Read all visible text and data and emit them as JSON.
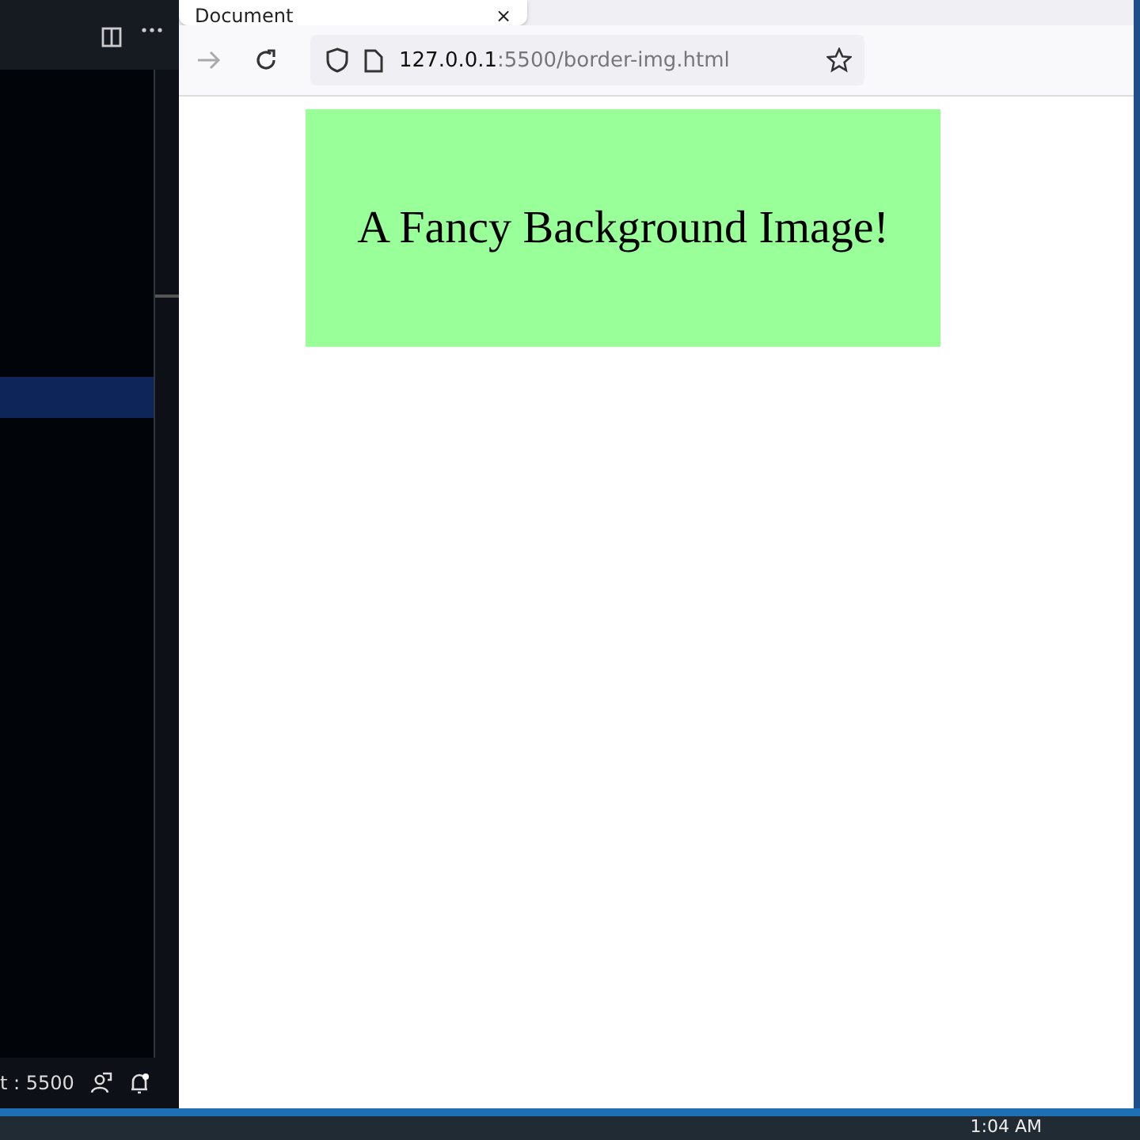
{
  "editor": {
    "status_port": "t : 5500"
  },
  "browser": {
    "tab": {
      "title": "Document",
      "close": "×"
    },
    "address": {
      "host": "127.0.0.1",
      "rest": ":5500/border-img.html"
    }
  },
  "page": {
    "heading": "A Fancy Background Image!"
  },
  "taskbar": {
    "time": "1:04 AM"
  }
}
